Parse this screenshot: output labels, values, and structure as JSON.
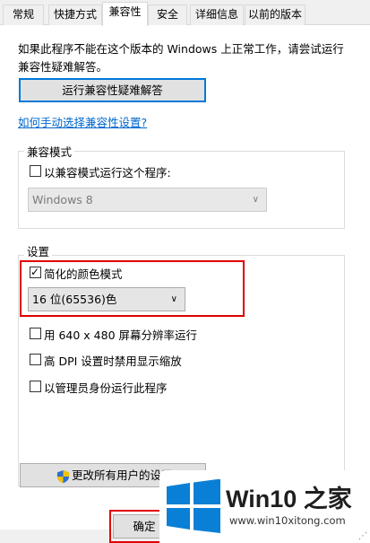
{
  "tabs": [
    {
      "label": "常规"
    },
    {
      "label": "快捷方式"
    },
    {
      "label": "兼容性",
      "active": true
    },
    {
      "label": "安全"
    },
    {
      "label": "详细信息"
    },
    {
      "label": "以前的版本"
    }
  ],
  "intro_text": "如果此程序不能在这个版本的 Windows 上正常工作，请尝试运行兼容性疑难解答。",
  "troubleshoot_button": "运行兼容性疑难解答",
  "manual_link": "如何手动选择兼容性设置?",
  "compat_mode": {
    "legend": "兼容模式",
    "checkbox_label": "以兼容模式运行这个程序:",
    "checkbox_checked": false,
    "os_select_value": "Windows 8"
  },
  "settings": {
    "legend": "设置",
    "reduced_color": {
      "label": "简化的颜色模式",
      "checked": true
    },
    "color_depth_value": "16 位(65536)色",
    "res_640": {
      "label": "用 640 x 480 屏幕分辨率运行",
      "checked": false
    },
    "high_dpi": {
      "label": "高 DPI 设置时禁用显示缩放",
      "checked": false
    },
    "run_admin": {
      "label": "以管理员身份运行此程序",
      "checked": false
    }
  },
  "change_all_users_button": "更改所有用户的设置",
  "ok_button": "确定",
  "icons": {
    "shield": "uac-shield-icon",
    "logo": "windows-logo-icon"
  },
  "watermark": {
    "title": "Win10 之家",
    "url": "www.win10xitong.com"
  },
  "colors": {
    "accent": "#0078d7",
    "highlight": "#e00000",
    "link": "#0066cc",
    "logo": "#0a7fd6"
  }
}
